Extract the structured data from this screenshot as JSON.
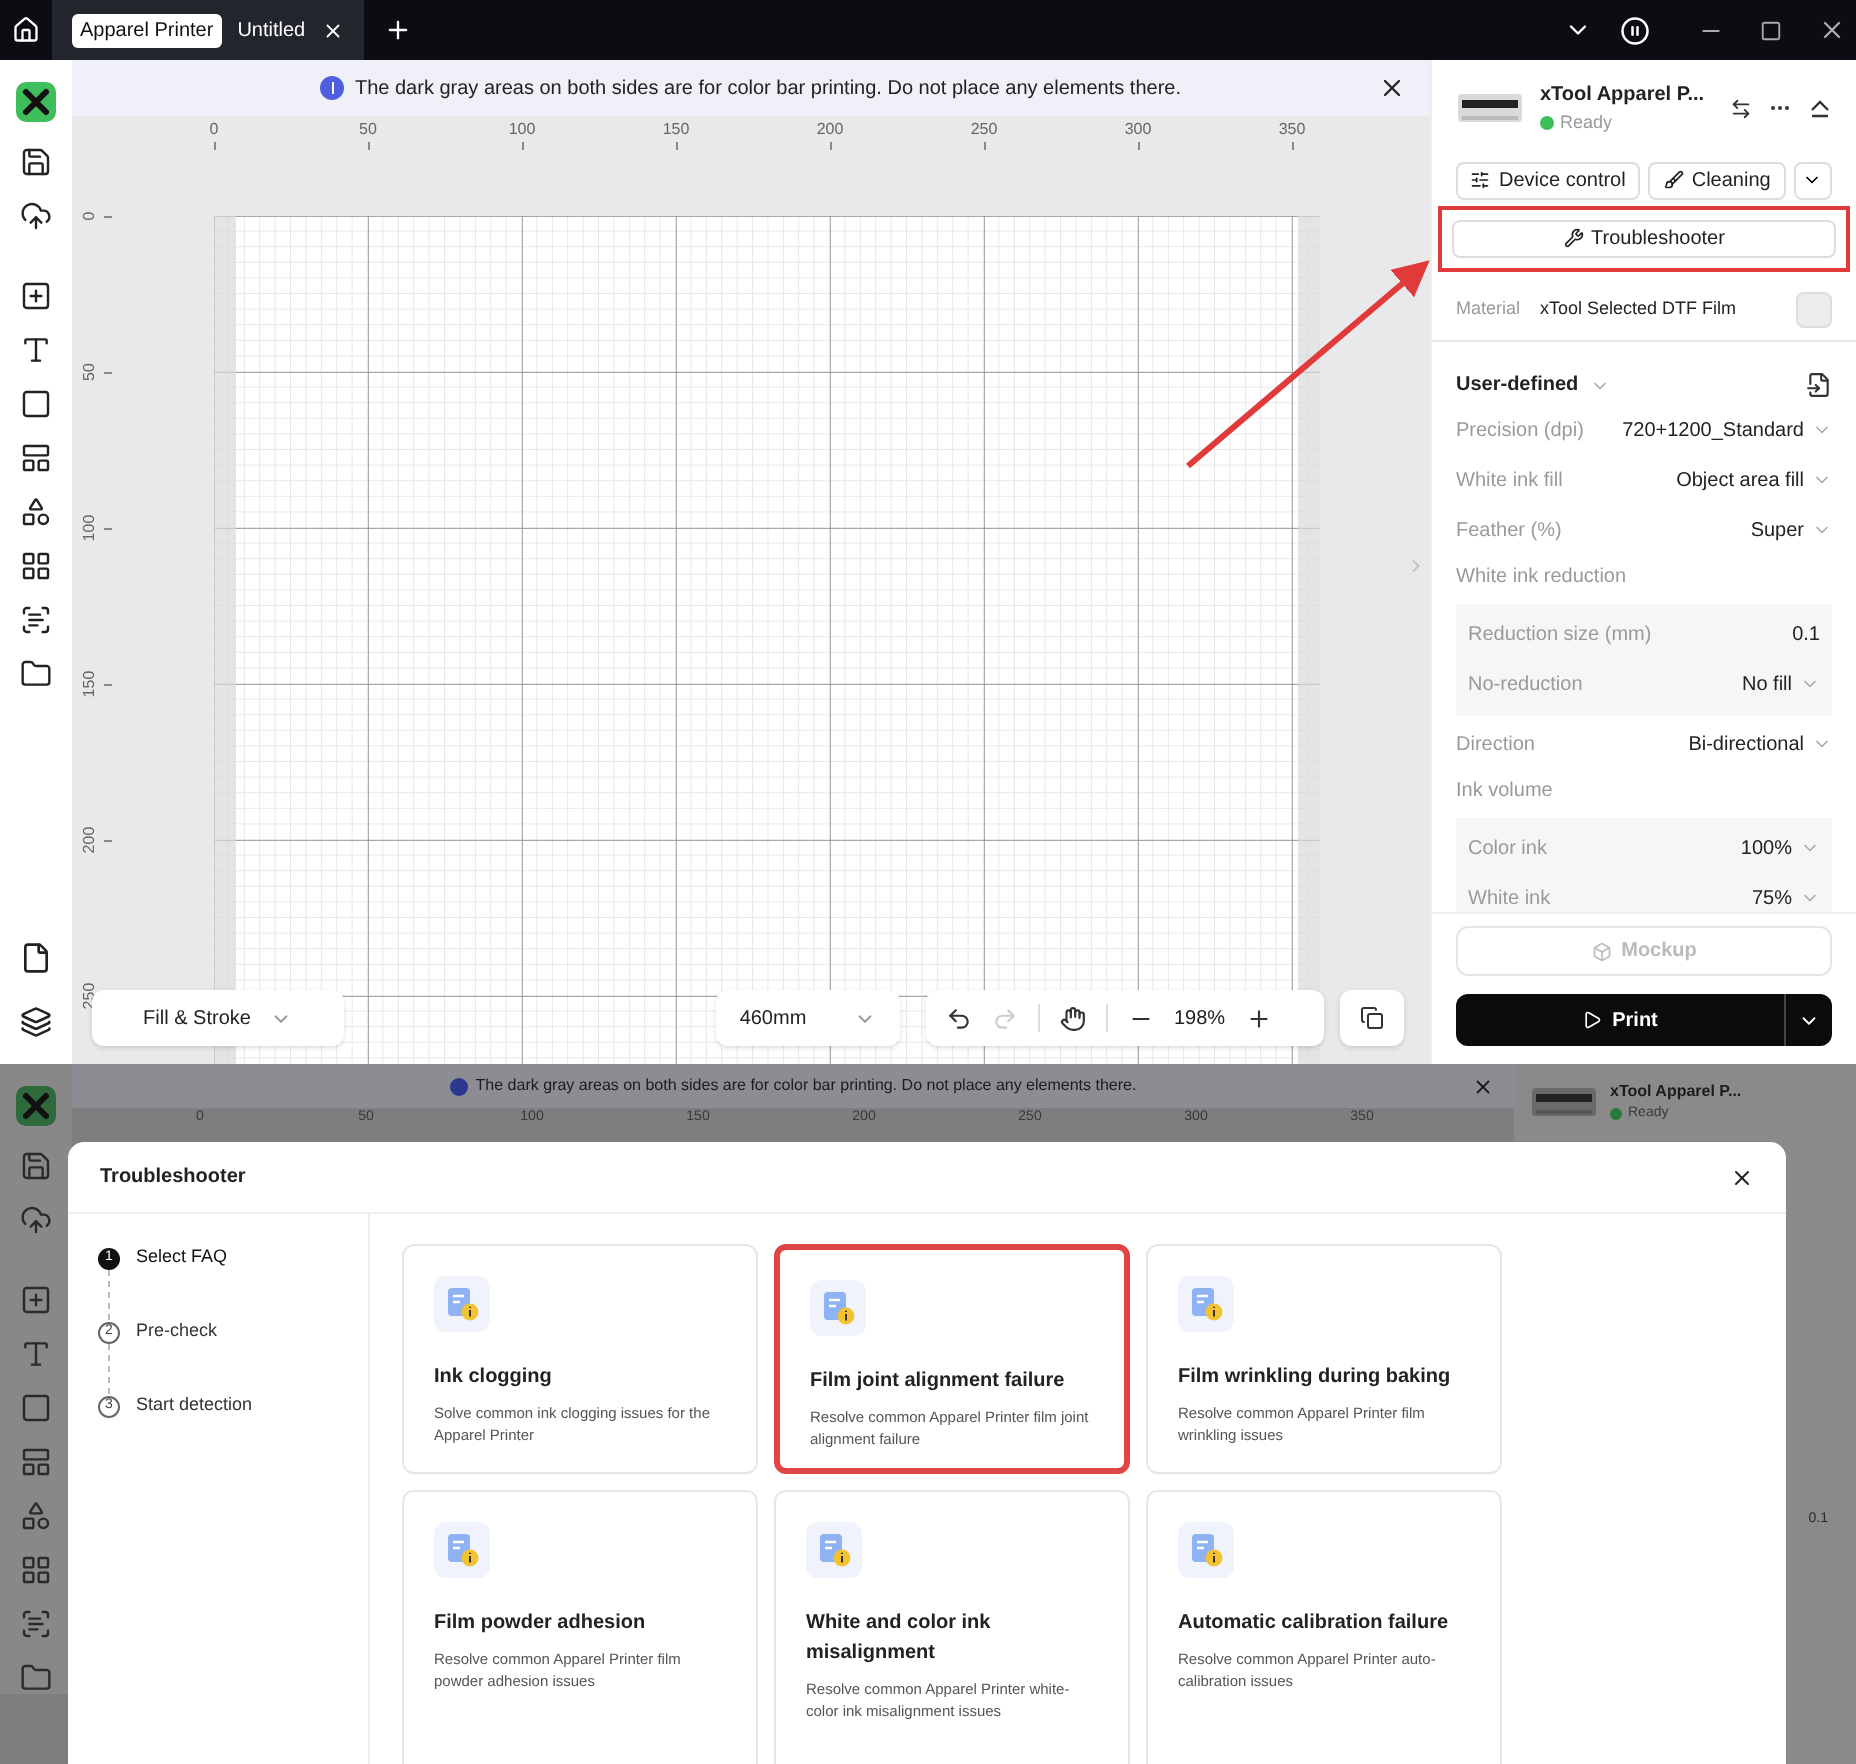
{
  "title_bar": {
    "tabs": [
      {
        "badge": "Apparel Printer",
        "title": "Untitled",
        "selected": true
      }
    ]
  },
  "notice": {
    "text": "The dark gray areas on both sides are for color bar printing. Do not place any elements there."
  },
  "ruler": {
    "x_labels": [
      "0",
      "50",
      "100",
      "150",
      "200",
      "250",
      "300",
      "350"
    ],
    "y_labels": [
      "0",
      "50",
      "100",
      "150",
      "200",
      "250"
    ]
  },
  "canvas_toolbar": {
    "fill_stroke": "Fill & Stroke",
    "size": "460mm",
    "zoom": "198%"
  },
  "device": {
    "name": "xTool Apparel P...",
    "status": "Ready",
    "online": true
  },
  "device_buttons": [
    {
      "label": "Device control",
      "kind": "control"
    },
    {
      "label": "Cleaning",
      "kind": "cleaning"
    }
  ],
  "troubleshooter": {
    "label": "Troubleshooter",
    "highlighted": true
  },
  "material": {
    "label": "Material",
    "value": "xTool Selected DTF Film"
  },
  "preset": {
    "label": "User-defined"
  },
  "settings": [
    {
      "kind": "row",
      "label": "Precision (dpi)",
      "value": "720+1200_Standard",
      "dropdown": true
    },
    {
      "kind": "row",
      "label": "White ink fill",
      "value": "Object area fill",
      "dropdown": true
    },
    {
      "kind": "row",
      "label": "Feather (%)",
      "value": "Super",
      "dropdown": true
    },
    {
      "kind": "heading",
      "label": "White ink reduction"
    },
    {
      "kind": "group",
      "rows": [
        {
          "label": "Reduction size (mm)",
          "value": "0.1",
          "dropdown": false
        },
        {
          "label": "No-reduction",
          "value": "No fill",
          "dropdown": true
        }
      ]
    },
    {
      "kind": "row",
      "label": "Direction",
      "value": "Bi-directional",
      "dropdown": true
    },
    {
      "kind": "heading",
      "label": "Ink volume"
    },
    {
      "kind": "group",
      "rows": [
        {
          "label": "Color ink",
          "value": "100%",
          "dropdown": true
        },
        {
          "label": "White ink",
          "value": "75%",
          "dropdown": true
        }
      ]
    }
  ],
  "mockup": {
    "label": "Mockup",
    "disabled": true
  },
  "print": {
    "label": "Print"
  },
  "background": {
    "notice": "The dark gray areas on both sides are for color bar printing. Do not place any elements there.",
    "ruler_labels": [
      "0",
      "50",
      "100",
      "150",
      "200",
      "250",
      "300",
      "350"
    ],
    "device_name": "xTool Apparel P...",
    "status": "Ready",
    "side_value": "0.1"
  },
  "dialog": {
    "title": "Troubleshooter",
    "steps": [
      {
        "number": "1",
        "label": "Select FAQ",
        "selected": true
      },
      {
        "number": "2",
        "label": "Pre-check",
        "selected": false
      },
      {
        "number": "3",
        "label": "Start detection",
        "selected": false
      }
    ],
    "cards": [
      {
        "title": "Ink clogging",
        "description": "Solve common ink clogging issues for the Apparel Printer",
        "highlighted": false
      },
      {
        "title": "Film joint alignment failure",
        "description": "Resolve common Apparel Printer film joint alignment failure",
        "highlighted": true
      },
      {
        "title": "Film wrinkling during baking",
        "description": "Resolve common Apparel Printer film wrinkling issues",
        "highlighted": false
      },
      {
        "title": "Film powder adhesion",
        "description": "Resolve common Apparel Printer film powder adhesion issues",
        "highlighted": false
      },
      {
        "title": "White and color ink misalignment",
        "description": "Resolve common Apparel Printer white-color ink misalignment issues",
        "highlighted": false
      },
      {
        "title": "Automatic calibration failure",
        "description": "Resolve common Apparel Printer auto-calibration issues",
        "highlighted": false
      }
    ]
  }
}
